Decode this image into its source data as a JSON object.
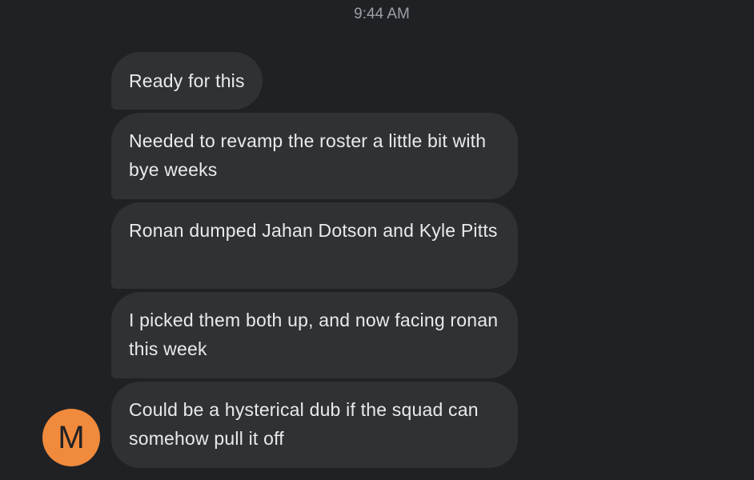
{
  "conversation": {
    "timestamp": "9:44 AM",
    "messages": [
      {
        "text": "Ready for this"
      },
      {
        "text": "Needed to revamp the roster a little bit with bye weeks"
      },
      {
        "text": "Ronan dumped Jahan Dotson and Kyle Pitts"
      },
      {
        "text": "I picked them both up, and now facing ronan this week"
      },
      {
        "text": "Could be a hysterical dub if the squad can somehow pull it off"
      }
    ],
    "sender": {
      "initial": "M",
      "avatar_color": "#f08a3c"
    }
  },
  "colors": {
    "background": "#202124",
    "bubble": "#303134",
    "text": "#e8eaed",
    "timestamp": "#9aa0a6"
  }
}
